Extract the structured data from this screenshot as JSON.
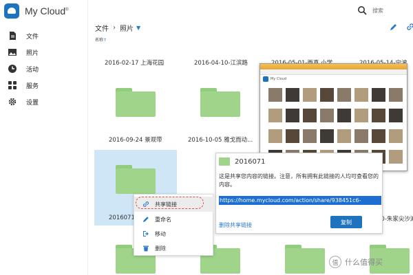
{
  "app": {
    "logo_text": "My Cloud",
    "logo_reg": "®"
  },
  "sidebar": {
    "items": [
      {
        "label": "文件",
        "icon": "document-icon"
      },
      {
        "label": "照片",
        "icon": "photo-icon"
      },
      {
        "label": "活动",
        "icon": "clock-icon"
      },
      {
        "label": "服务",
        "icon": "grid-icon"
      },
      {
        "label": "设置",
        "icon": "gear-icon"
      }
    ]
  },
  "header": {
    "search_placeholder": "搜索",
    "breadcrumb": [
      "文件",
      "照片"
    ],
    "sort_label": "名称",
    "sort_arrow": "↑"
  },
  "folders": [
    {
      "name": "2016-02-17 上海花园"
    },
    {
      "name": "2016-04-10-江滨路"
    },
    {
      "name": "2016-05-01-西真 小学..."
    },
    {
      "name": "2016-05-14-宁波"
    },
    {
      "name": "2016-09-24 景观带"
    },
    {
      "name": "2016-10-05 雅戈而动..."
    },
    {
      "name": "201607..."
    }
  ],
  "behind_labels": {
    "left": "2016071(",
    "right": "20-朱家尖沙滩"
  },
  "thumb_window": {
    "title": "My Cloud"
  },
  "share_dialog": {
    "folder_name": "2016071",
    "message": "这是共享您内容的链接。注意，所有拥有此链接的人均可查看您的内容。",
    "url": "https://home.mycloud.com/action/share/938451c6-",
    "delete_link": "删除共享链接",
    "copy_button": "复制"
  },
  "context_menu": {
    "items": [
      {
        "label": "共享链接",
        "icon": "link-icon"
      },
      {
        "label": "重命名",
        "icon": "pencil-icon"
      },
      {
        "label": "移动",
        "icon": "move-icon"
      },
      {
        "label": "删除",
        "icon": "trash-icon"
      }
    ]
  },
  "watermark": {
    "glyph": "值",
    "text": "什么值得买"
  },
  "colors": {
    "accent": "#1e73be",
    "folder": "#9fd48a",
    "selection": "#cfe6f7"
  }
}
